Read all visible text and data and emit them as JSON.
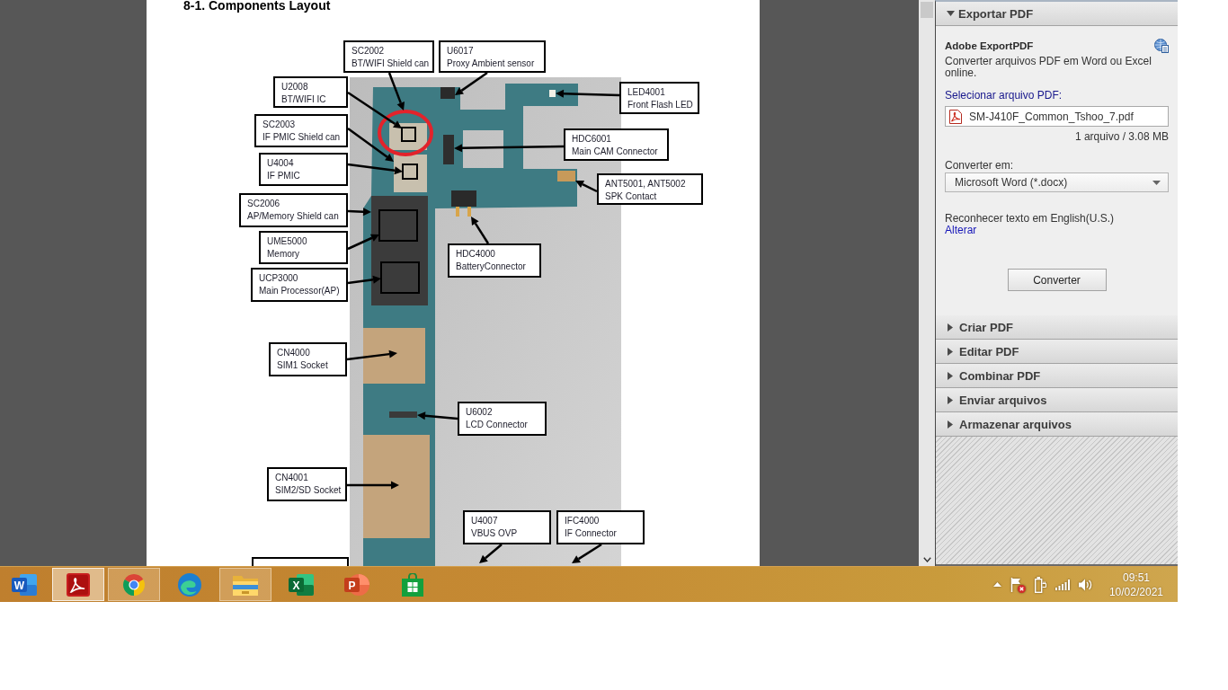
{
  "document": {
    "heading": "8-1. Components Layout",
    "callouts": [
      {
        "ref": "SC2002",
        "desc": "BT/WIFI Shield can"
      },
      {
        "ref": "U6017",
        "desc": "Proxy Ambient sensor"
      },
      {
        "ref": "U2008",
        "desc": "BT/WIFI IC"
      },
      {
        "ref": "LED4001",
        "desc": "Front Flash LED"
      },
      {
        "ref": "SC2003",
        "desc": "IF PMIC Shield can"
      },
      {
        "ref": "HDC6001",
        "desc": "Main CAM Connector"
      },
      {
        "ref": "U4004",
        "desc": "IF PMIC"
      },
      {
        "ref": "ANT5001, ANT5002",
        "desc": "SPK Contact"
      },
      {
        "ref": "SC2006",
        "desc": "AP/Memory Shield can"
      },
      {
        "ref": "UME5000",
        "desc": "Memory"
      },
      {
        "ref": "HDC4000",
        "desc": "BatteryConnector"
      },
      {
        "ref": "UCP3000",
        "desc": "Main Processor(AP)"
      },
      {
        "ref": "CN4000",
        "desc": "SIM1 Socket"
      },
      {
        "ref": "U6002",
        "desc": "LCD Connector"
      },
      {
        "ref": "CN4001",
        "desc": "SIM2/SD Socket"
      },
      {
        "ref": "U4007",
        "desc": "VBUS OVP"
      },
      {
        "ref": "IFC4000",
        "desc": "IF Connector"
      }
    ]
  },
  "panel": {
    "sections": [
      {
        "title": "Exportar PDF",
        "expanded": true,
        "content": {
          "heading": "Adobe ExportPDF",
          "description": "Converter arquivos PDF em Word ou Excel online.",
          "select_label": "Selecionar arquivo PDF:",
          "file": "SM-J410F_Common_Tshoo_7.pdf",
          "file_info": "1 arquivo / 3.08 MB",
          "convert_label": "Converter em:",
          "format": "Microsoft Word (*.docx)",
          "ocr_text": "Reconhecer texto em English(U.S.)",
          "ocr_link": "Alterar",
          "button": "Converter"
        }
      },
      {
        "title": "Criar PDF",
        "expanded": false
      },
      {
        "title": "Editar PDF",
        "expanded": false
      },
      {
        "title": "Combinar PDF",
        "expanded": false
      },
      {
        "title": "Enviar arquivos",
        "expanded": false
      },
      {
        "title": "Armazenar arquivos",
        "expanded": false
      }
    ]
  },
  "taskbar": {
    "apps": [
      {
        "kind": "word",
        "glyph": "W",
        "running": false,
        "selected": false
      },
      {
        "kind": "acrobat",
        "running": true,
        "selected": true
      },
      {
        "kind": "chrome",
        "running": true,
        "selected": false
      },
      {
        "kind": "edge",
        "running": false,
        "selected": false
      },
      {
        "kind": "explorer",
        "running": true,
        "selected": false
      },
      {
        "kind": "excel",
        "glyph": "X",
        "running": false,
        "selected": false
      },
      {
        "kind": "powerpoint",
        "glyph": "P",
        "running": false,
        "selected": false
      },
      {
        "kind": "store",
        "running": false,
        "selected": false
      }
    ],
    "clock": {
      "time": "09:51",
      "date": "10/02/2021"
    }
  }
}
